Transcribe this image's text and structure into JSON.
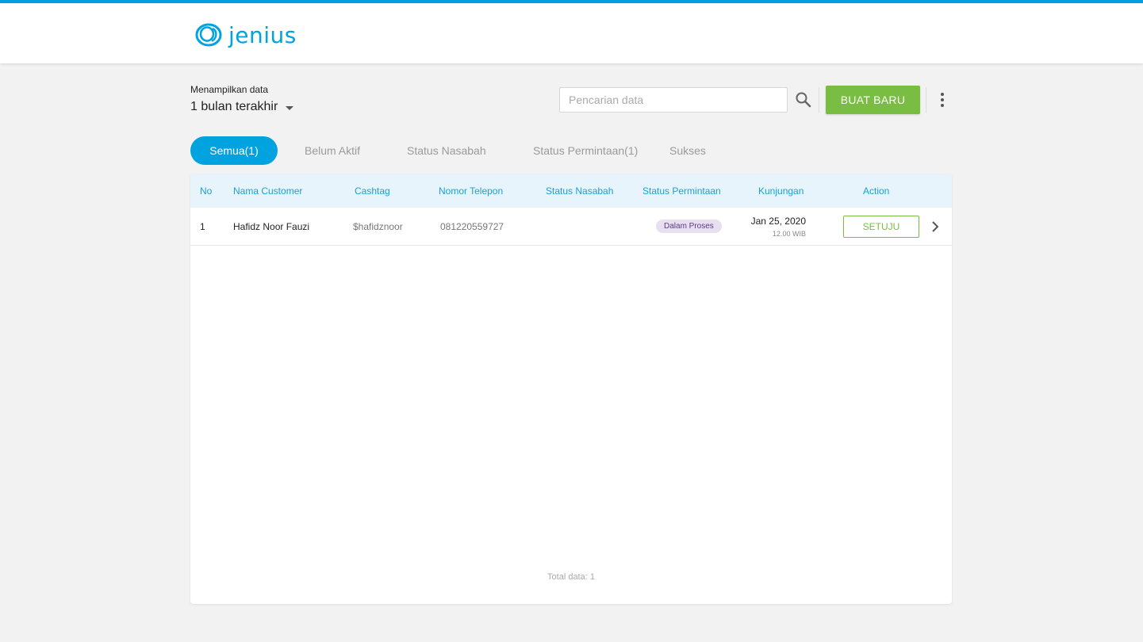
{
  "brand": {
    "name": "jenius",
    "accent_color": "#00a3e0",
    "green_color": "#79bd42"
  },
  "filter": {
    "label": "Menampilkan data",
    "value": "1 bulan terakhir"
  },
  "search": {
    "placeholder": "Pencarian data",
    "value": ""
  },
  "toolbar": {
    "create_label": "BUAT BARU"
  },
  "tabs": [
    {
      "label": "Semua(1)",
      "active": true
    },
    {
      "label": "Belum Aktif",
      "active": false
    },
    {
      "label": "Status Nasabah",
      "active": false
    },
    {
      "label": "Status Permintaan(1)",
      "active": false
    },
    {
      "label": "Sukses",
      "active": false
    }
  ],
  "table": {
    "columns": [
      "No",
      "Nama Customer",
      "Cashtag",
      "Nomor Telepon",
      "Status Nasabah",
      "Status Permintaan",
      "Kunjungan",
      "Action"
    ],
    "rows": [
      {
        "no": "1",
        "name": "Hafidz Noor Fauzi",
        "cashtag": "$hafidznoor",
        "phone": "081220559727",
        "status_nasabah": "",
        "status_permintaan": "Dalam Proses",
        "visit_date": "Jan 25, 2020",
        "visit_time": "12.00 WIB",
        "action_label": "SETUJU"
      }
    ],
    "total_label": "Total data: 1"
  },
  "icons": {
    "logo": "jenius-logo-icon",
    "search": "search-icon",
    "more": "more-vertical-icon",
    "dropdown": "caret-down-icon",
    "row_open": "chevron-right-icon"
  }
}
